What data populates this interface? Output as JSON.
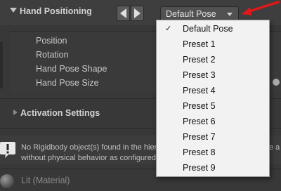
{
  "inspector": {
    "section_title": "Hand Positioning",
    "pose_dropdown_value": "Default Pose",
    "properties": [
      "Position",
      "Rotation",
      "Hand Pose Shape",
      "Hand Pose Size"
    ],
    "activation_title": "Activation Settings",
    "warning": {
      "line1": "No Rigidbody object(s) found in the hier",
      "line2": "without physical behavior as configured",
      "tail": "e a"
    },
    "material_label": "Lit (Material)"
  },
  "menu": {
    "selected": "Default Pose",
    "items": [
      "Default Pose",
      "Preset 1",
      "Preset 2",
      "Preset 3",
      "Preset 4",
      "Preset 5",
      "Preset 6",
      "Preset 7",
      "Preset 8",
      "Preset 9"
    ]
  },
  "colors": {
    "annotation_arrow": "#e01818",
    "menu_background": "#f2f2f2",
    "inspector_background": "#383838"
  },
  "icons": {
    "section_foldout": "triangle-down",
    "prev": "triangle-left",
    "next": "triangle-right",
    "warning": "exclamation-bubble",
    "checkmark": "✓"
  }
}
